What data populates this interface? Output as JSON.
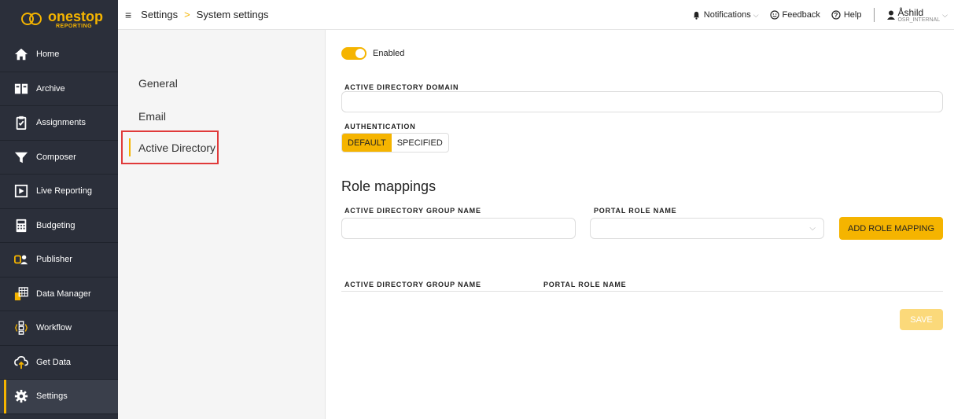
{
  "brand": {
    "name": "onestop",
    "sub": "REPORTING"
  },
  "sidebar": {
    "items": [
      {
        "label": "Home",
        "icon": "home-icon"
      },
      {
        "label": "Archive",
        "icon": "archive-icon"
      },
      {
        "label": "Assignments",
        "icon": "clipboard-icon"
      },
      {
        "label": "Composer",
        "icon": "funnel-icon"
      },
      {
        "label": "Live Reporting",
        "icon": "play-icon"
      },
      {
        "label": "Budgeting",
        "icon": "calculator-icon"
      },
      {
        "label": "Publisher",
        "icon": "publisher-icon"
      },
      {
        "label": "Data Manager",
        "icon": "data-manager-icon"
      },
      {
        "label": "Workflow",
        "icon": "workflow-icon"
      },
      {
        "label": "Get Data",
        "icon": "cloud-upload-icon"
      },
      {
        "label": "Settings",
        "icon": "gear-icon",
        "active": true
      }
    ]
  },
  "header": {
    "breadcrumb": [
      "Settings",
      "System settings"
    ],
    "separator": ">",
    "notifications": "Notifications",
    "feedback": "Feedback",
    "help": "Help",
    "user_name": "Åshild",
    "user_org": "OSR_INTERNAL"
  },
  "subnav": {
    "items": [
      "General",
      "Email",
      "Active Directory"
    ],
    "active": "Active Directory"
  },
  "form": {
    "enabled_label": "Enabled",
    "enabled": true,
    "domain_label": "ACTIVE DIRECTORY DOMAIN",
    "domain_value": "",
    "auth_label": "AUTHENTICATION",
    "auth_options": [
      "DEFAULT",
      "SPECIFIED"
    ],
    "auth_selected": "DEFAULT"
  },
  "role_mappings": {
    "title": "Role mappings",
    "group_label": "ACTIVE DIRECTORY GROUP NAME",
    "role_label": "PORTAL ROLE NAME",
    "add_button": "ADD ROLE MAPPING",
    "table_headers": [
      "ACTIVE DIRECTORY GROUP NAME",
      "PORTAL ROLE NAME"
    ],
    "rows": [],
    "save_button": "SAVE"
  },
  "colors": {
    "accent": "#f5b400",
    "sidebar": "#2b2f3a",
    "highlight": "#e03a3a"
  }
}
